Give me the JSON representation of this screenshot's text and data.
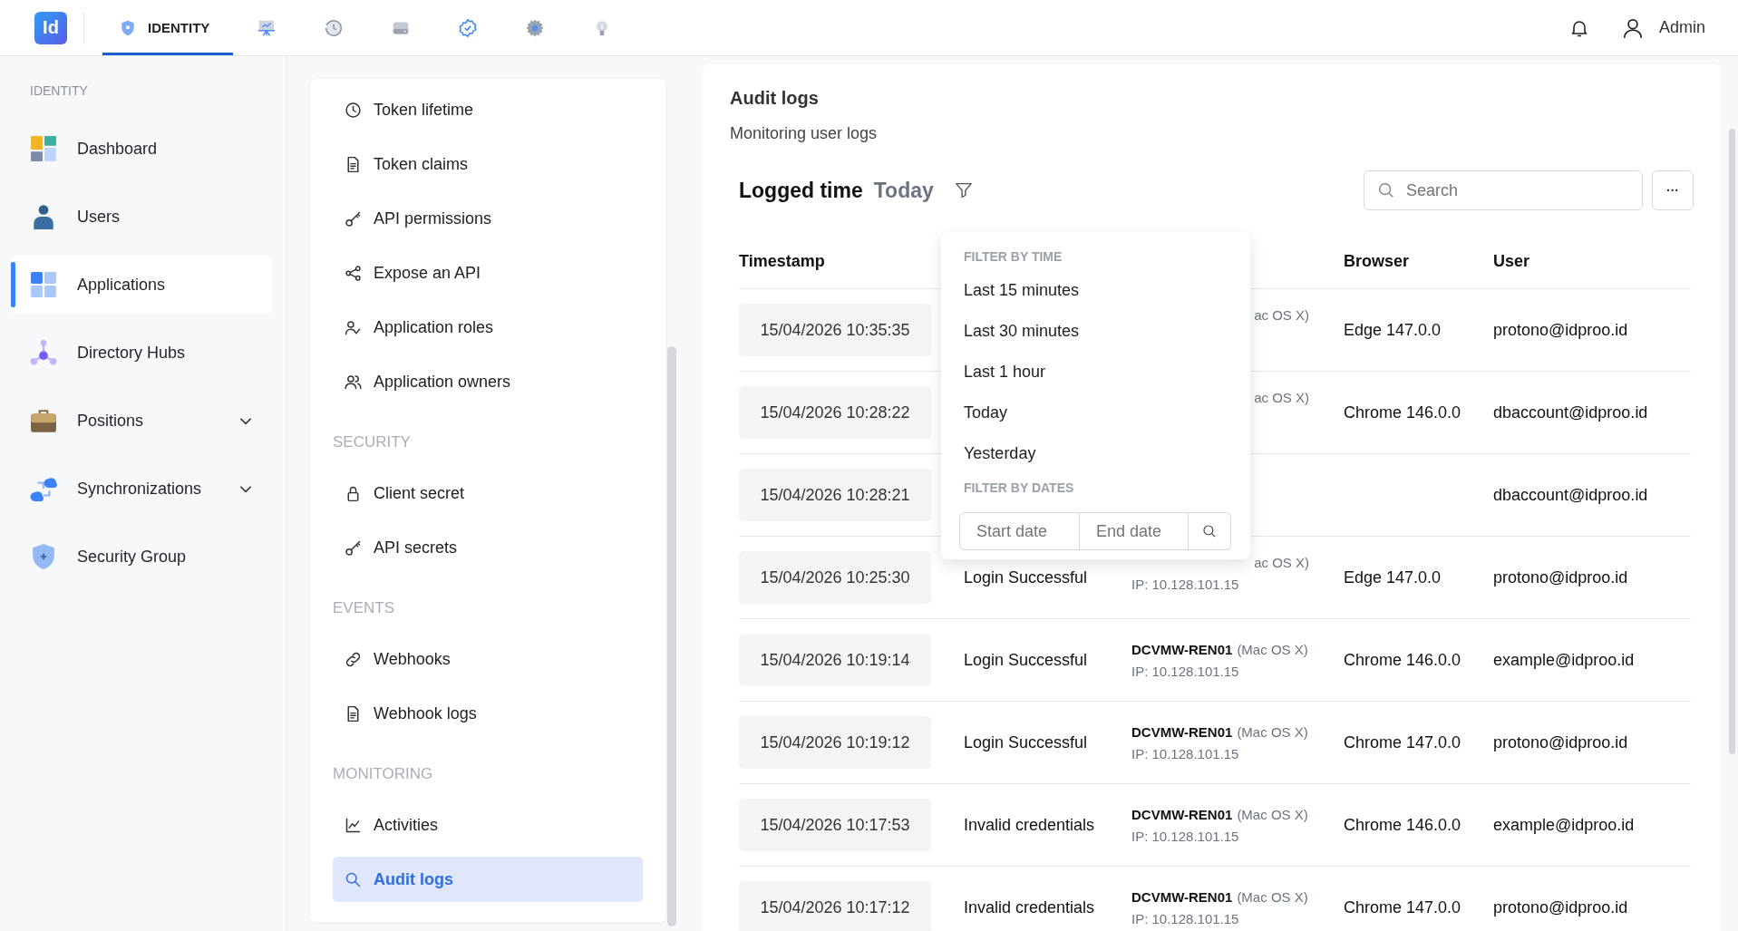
{
  "topbar": {
    "logo": "Id",
    "tabs": [
      {
        "label": "IDENTITY",
        "selected": true
      },
      {
        "selected": false
      },
      {
        "selected": false
      },
      {
        "selected": false
      },
      {
        "selected": false
      },
      {
        "selected": false
      },
      {
        "selected": false
      }
    ],
    "user": "Admin"
  },
  "sidebar": {
    "heading": "IDENTITY",
    "items": [
      {
        "label": "Dashboard",
        "selected": false,
        "expandable": false
      },
      {
        "label": "Users",
        "selected": false,
        "expandable": false
      },
      {
        "label": "Applications",
        "selected": true,
        "expandable": false
      },
      {
        "label": "Directory Hubs",
        "selected": false,
        "expandable": false
      },
      {
        "label": "Positions",
        "selected": false,
        "expandable": true
      },
      {
        "label": "Synchronizations",
        "selected": false,
        "expandable": true
      },
      {
        "label": "Security Group",
        "selected": false,
        "expandable": false
      }
    ]
  },
  "submenu": {
    "sections": [
      {
        "items": [
          {
            "label": "Token lifetime",
            "selected": false
          },
          {
            "label": "Token claims",
            "selected": false
          },
          {
            "label": "API permissions",
            "selected": false
          },
          {
            "label": "Expose an API",
            "selected": false
          },
          {
            "label": "Application roles",
            "selected": false
          },
          {
            "label": "Application owners",
            "selected": false
          }
        ]
      },
      {
        "title": "SECURITY",
        "items": [
          {
            "label": "Client secret",
            "selected": false
          },
          {
            "label": "API secrets",
            "selected": false
          }
        ]
      },
      {
        "title": "EVENTS",
        "items": [
          {
            "label": "Webhooks",
            "selected": false
          },
          {
            "label": "Webhook logs",
            "selected": false
          }
        ]
      },
      {
        "title": "MONITORING",
        "items": [
          {
            "label": "Activities",
            "selected": false
          },
          {
            "label": "Audit logs",
            "selected": true
          }
        ]
      }
    ]
  },
  "main": {
    "title": "Audit logs",
    "subtitle": "Monitoring user logs",
    "filter_label": "Logged time",
    "filter_value": "Today",
    "search": {
      "placeholder": "Search"
    },
    "more_button": "···",
    "table": {
      "columns": [
        "Timestamp",
        "Browser",
        "User"
      ],
      "rows": [
        {
          "timestamp": "15/04/2026 10:35:35",
          "os": "ac OS X)",
          "browser": "Edge 147.0.0",
          "user": "protono@idproo.id"
        },
        {
          "timestamp": "15/04/2026 10:28:22",
          "os": "ac OS X)",
          "browser": "Chrome 146.0.0",
          "user": "dbaccount@idproo.id"
        },
        {
          "timestamp": "15/04/2026 10:28:21",
          "user": "dbaccount@idproo.id"
        },
        {
          "timestamp": "15/04/2026 10:25:30",
          "event": "Login Successful",
          "os": "ac OS X)",
          "ip": "IP: 10.128.101.15",
          "browser": "Edge 147.0.0",
          "user": "protono@idproo.id"
        },
        {
          "timestamp": "15/04/2026 10:19:14",
          "event": "Login Successful",
          "device": "DCVMW-REN01",
          "os": "(Mac OS X)",
          "ip": "IP: 10.128.101.15",
          "browser": "Chrome 146.0.0",
          "user": "example@idproo.id"
        },
        {
          "timestamp": "15/04/2026 10:19:12",
          "event": "Login Successful",
          "device": "DCVMW-REN01",
          "os": "(Mac OS X)",
          "ip": "IP: 10.128.101.15",
          "browser": "Chrome 147.0.0",
          "user": "protono@idproo.id"
        },
        {
          "timestamp": "15/04/2026 10:17:53",
          "event": "Invalid credentials",
          "device": "DCVMW-REN01",
          "os": "(Mac OS X)",
          "ip": "IP: 10.128.101.15",
          "browser": "Chrome 146.0.0",
          "user": "example@idproo.id"
        },
        {
          "timestamp": "15/04/2026 10:17:12",
          "event": "Invalid credentials",
          "device": "DCVMW-REN01",
          "os": "(Mac OS X)",
          "ip": "IP: 10.128.101.15",
          "browser": "Chrome 147.0.0",
          "user": "protono@idproo.id"
        }
      ]
    },
    "dropdown": {
      "time_title": "FILTER BY TIME",
      "options": [
        "Last 15 minutes",
        "Last 30 minutes",
        "Last 1 hour",
        "Today",
        "Yesterday"
      ],
      "dates_title": "FILTER BY DATES",
      "start_placeholder": "Start date",
      "end_placeholder": "End date"
    }
  }
}
